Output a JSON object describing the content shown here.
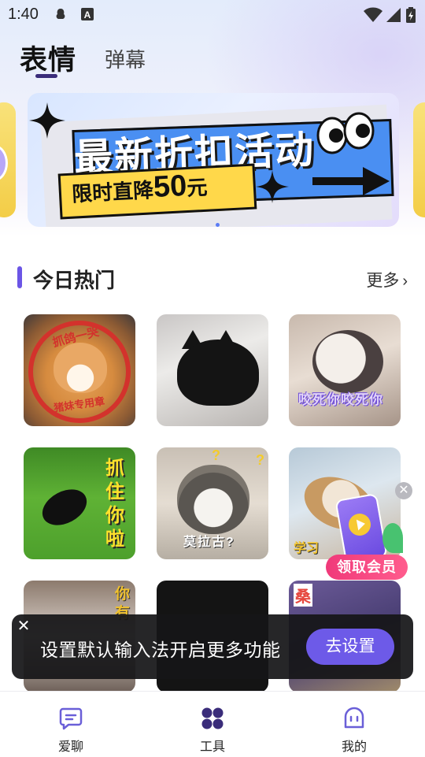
{
  "status_bar": {
    "time": "1:40"
  },
  "header": {
    "tabs": [
      {
        "label": "表情",
        "active": true
      },
      {
        "label": "弹幕",
        "active": false
      }
    ]
  },
  "banner": {
    "title": "最新折扣活动",
    "subtitle_prefix": "限时直降",
    "subtitle_amount": "50",
    "subtitle_unit": "元",
    "active_index": 0
  },
  "section": {
    "title": "今日热门",
    "more_label": "更多"
  },
  "stickers": [
    {
      "caption_top": "抓鸽一哭",
      "caption_bottom": "猪妹专用章"
    },
    {
      "caption": ""
    },
    {
      "caption": "咬死你咬死你"
    },
    {
      "caption": "抓住你啦"
    },
    {
      "caption": "莫拉古?"
    },
    {
      "caption": "学习"
    },
    {
      "caption": "你有"
    },
    {
      "caption": ""
    },
    {
      "caption": "桑"
    }
  ],
  "promo": {
    "label": "领取会员"
  },
  "toast": {
    "message": "设置默认输入法开启更多功能",
    "button_label": "去设置"
  },
  "bottom_nav": {
    "items": [
      {
        "label": "爱聊",
        "icon": "chat-icon",
        "active": false
      },
      {
        "label": "工具",
        "icon": "tools-icon",
        "active": true
      },
      {
        "label": "我的",
        "icon": "profile-icon",
        "active": false
      }
    ]
  },
  "colors": {
    "accent": "#6d5ae8",
    "active_nav": "#3a2c7a",
    "promo_pink": "#f0397a"
  }
}
